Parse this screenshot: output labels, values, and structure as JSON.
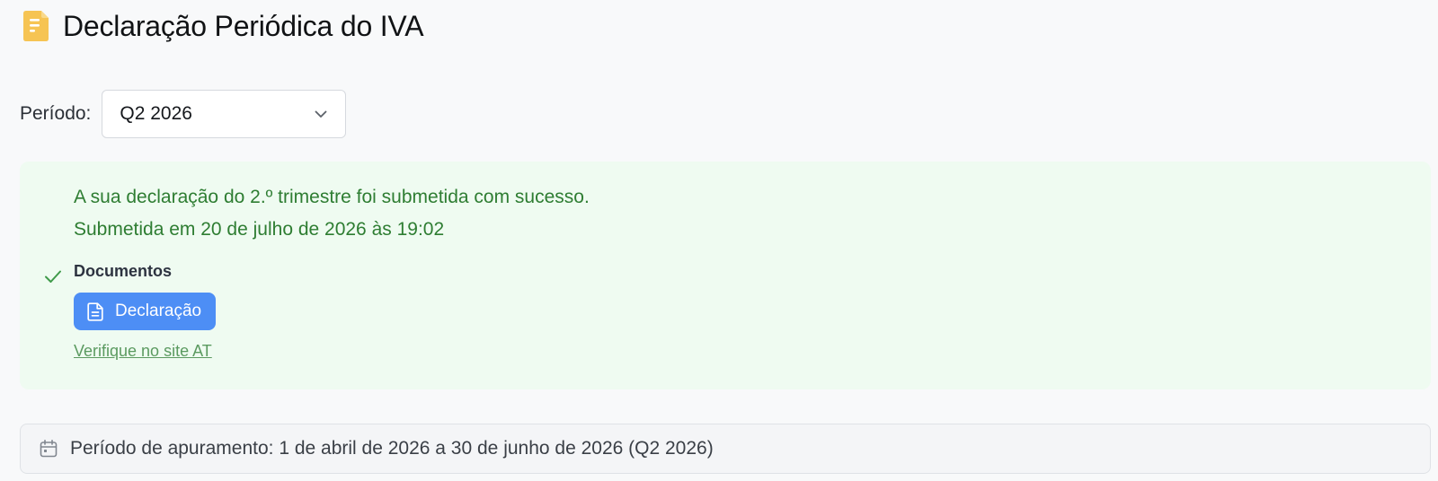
{
  "header": {
    "title": "Declaração Periódica do IVA",
    "icon": "document-icon",
    "icon_color": "#f6c453"
  },
  "period_selector": {
    "label": "Período:",
    "selected_value": "Q2 2026",
    "icon": "chevron-down-icon"
  },
  "success": {
    "message": "A sua declaração do 2.º trimestre foi submetida com sucesso.",
    "submitted_at": "Submetida em 20 de julho de 2026 às 19:02",
    "documents_heading": "Documentos",
    "declaration_button_label": "Declaração",
    "verify_link_label": "Verifique no site AT",
    "text_color": "#2e7d32",
    "background_color": "#effbf1",
    "button_color": "#4d8ef5"
  },
  "period_info": {
    "text": "Período de apuramento: 1 de abril de 2026 a 30 de junho de 2026 (Q2 2026)",
    "icon": "calendar-icon"
  }
}
